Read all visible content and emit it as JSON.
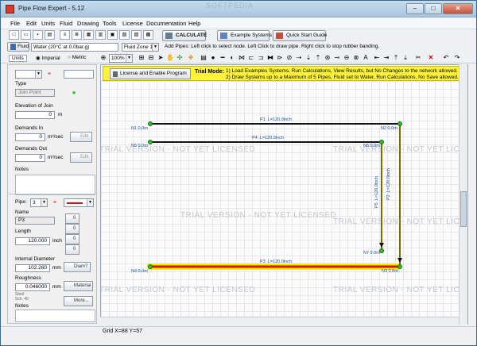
{
  "window": {
    "title": "Pipe Flow Expert - 5.12",
    "watermark": "SOFTPEDIA"
  },
  "menu": [
    "File",
    "Edit",
    "Units",
    "Fluid",
    "Drawing",
    "Tools",
    "License",
    "Documentation",
    "Help"
  ],
  "toolbar": {
    "calculate": "CALCULATE",
    "examples": "Example Systems",
    "quickstart": "Quick Start Guide"
  },
  "fluid_bar": {
    "fluid_label": "Fluid",
    "fluid_value": "Water (20°C at 0.0bar.g)",
    "zone_value": "Fluid Zone 1",
    "hint": "Add Pipes: Left click to select node. Left Click to draw pipe. Right click to stop rubber banding."
  },
  "units_bar": {
    "units_tab": "Units",
    "imperial": "Imperial",
    "metric": "Metric",
    "zoom": "100%"
  },
  "left_panel": {
    "type_label": "Type",
    "type_value": "Join Point",
    "elevation_label": "Elevation of Join",
    "elevation_value": "0",
    "elevation_unit": "m",
    "demands_in_label": "Demands In",
    "demands_in_value": "0",
    "demands_in_unit": "m³/sec",
    "demands_out_label": "Demands Out",
    "demands_out_value": "0",
    "demands_out_unit": "m³/sec",
    "edit_label": "Edit",
    "notes_label": "Notes",
    "pipe_label": "Pipe:",
    "pipe_number": "3",
    "name_label": "Name",
    "name_value": "P3",
    "length_label": "Length",
    "length_value": "120.000",
    "length_unit": "inch",
    "counter_values": [
      "0",
      "0",
      "0",
      "0"
    ],
    "diameter_label": "Internal Diameter",
    "diameter_value": "102.260",
    "diameter_unit": "mm",
    "diam_button": "Diam?",
    "roughness_label": "Roughness",
    "roughness_value": "0.046000",
    "roughness_unit": "mm",
    "material_button": "Material",
    "material_line1": "Steel",
    "material_line2": "Sch. 40",
    "more_button": "More...",
    "notes2_label": "Notes"
  },
  "trial": {
    "license_button": "License and Enable Program",
    "mode_label": "Trial Mode:",
    "line1": "1) Load Examples Systems, Run Calculations, View Results, but No Changes to the network allowed.   OR",
    "line2": "2) Draw Systems up to a Maximum of 5 Pipes, Fluid set to Water, Run Calculations, No Save allowed."
  },
  "watermark_text": "TRIAL VERSION - NOT YET LICENSED",
  "network": {
    "nodes": [
      "N1 0.0m",
      "N2 0.0m",
      "N3 0.0m",
      "N4 0.0m",
      "N5 0.0m",
      "N6 0.0m",
      "N7 0.0m"
    ],
    "pipes": [
      "P1 .L=120.0inch",
      "P2 .L=120.0inch",
      "P3 .L=120.0inch",
      "P4 .L=120.0inch",
      "P5 .L=120.0inch"
    ]
  },
  "status": {
    "grid": "Grid  X=88  Y=57"
  },
  "colors": {
    "selected_pipe": "#e01010",
    "highlight": "#f2ee00",
    "pipe": "#111111",
    "node": "#2fbf2f"
  }
}
